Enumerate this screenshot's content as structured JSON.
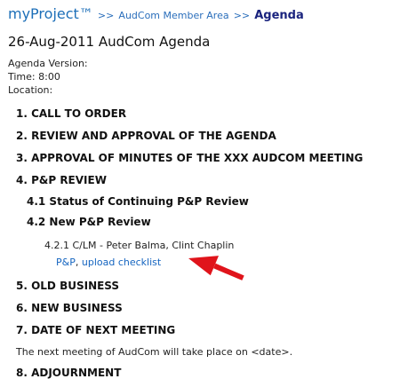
{
  "breadcrumb": {
    "brand": "myProject™",
    "separator": ">>",
    "member_area": "AudCom Member Area",
    "current": "Agenda"
  },
  "page_title": "26-Aug-2011 AudCom Agenda",
  "meta": {
    "version": "Agenda Version:",
    "time": "Time: 8:00",
    "location": "Location:"
  },
  "agenda": {
    "item1": "1. CALL TO ORDER",
    "item2": "2. REVIEW AND APPROVAL OF THE AGENDA",
    "item3": "3. APPROVAL OF MINUTES OF THE XXX AUDCOM MEETING",
    "item4": "4. P&P REVIEW",
    "item4_1": "4.1 Status of Continuing P&P Review",
    "item4_2": "4.2 New P&P Review",
    "item4_2_1": "4.2.1 C/LM - Peter Balma, Clint Chaplin",
    "link_pp": "P&P",
    "link_separator": ", ",
    "link_upload": "upload checklist",
    "item5": "5. OLD BUSINESS",
    "item6": "6. NEW BUSINESS",
    "item7": "7. DATE OF NEXT MEETING",
    "next_meeting_note": "The next meeting of AudCom will take place on <date>.",
    "item8": "8. ADJOURNMENT"
  },
  "colors": {
    "link": "#1565c0",
    "arrow": "#e0141b"
  }
}
